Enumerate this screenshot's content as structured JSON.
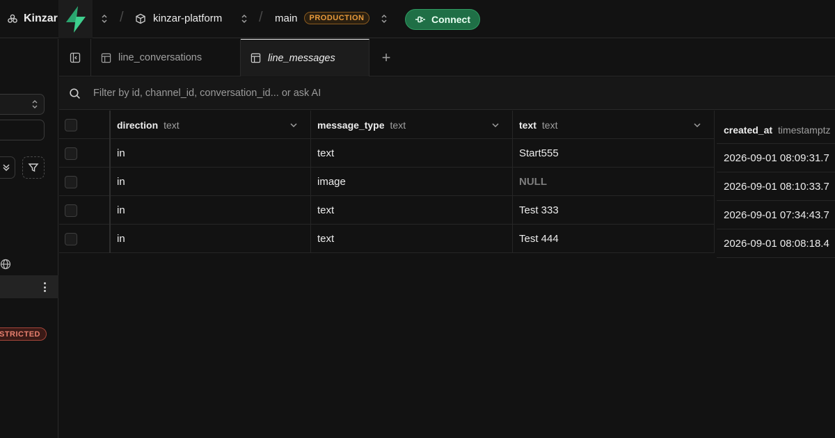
{
  "topbar": {
    "org_name": "Kinzar",
    "project_name": "kinzar-platform",
    "branch_name": "main",
    "branch_badge": "PRODUCTION",
    "connect_label": "Connect",
    "accent_color": "#3ecf8e"
  },
  "sidebar": {
    "restricted_badge": "STRICTED"
  },
  "tabs": [
    {
      "label": "line_conversations",
      "active": false
    },
    {
      "label": "line_messages",
      "active": true
    }
  ],
  "filter": {
    "placeholder": "Filter by id, channel_id, conversation_id... or ask AI",
    "value": ""
  },
  "table": {
    "columns": [
      {
        "name": "direction",
        "type": "text"
      },
      {
        "name": "message_type",
        "type": "text"
      },
      {
        "name": "text",
        "type": "text"
      },
      {
        "name": "created_at",
        "type": "timestamptz"
      }
    ],
    "rows": [
      {
        "direction": "in",
        "message_type": "text",
        "text": "Start555",
        "created_at": "2026-09-01 08:09:31.7"
      },
      {
        "direction": "in",
        "message_type": "image",
        "text": "NULL",
        "created_at": "2026-09-01 08:10:33.7"
      },
      {
        "direction": "in",
        "message_type": "text",
        "text": "Test 333",
        "created_at": "2026-09-01 07:34:43.7"
      },
      {
        "direction": "in",
        "message_type": "text",
        "text": "Test 444",
        "created_at": "2026-09-01 08:08:18.4"
      }
    ]
  }
}
